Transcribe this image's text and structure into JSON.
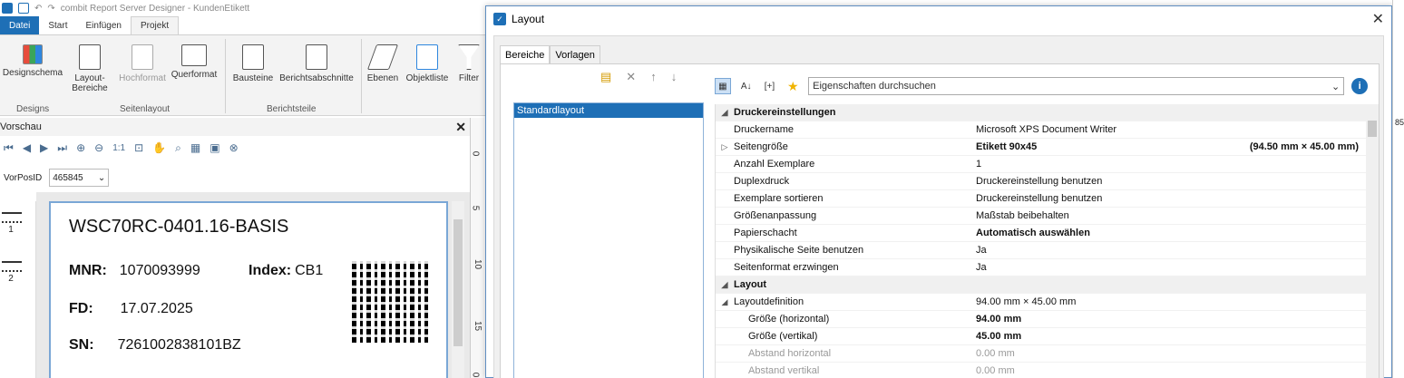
{
  "app": {
    "title": "combit Report Server Designer - KundenEtikett"
  },
  "menu": {
    "file": "Datei",
    "start": "Start",
    "insert": "Einfügen",
    "project": "Projekt"
  },
  "ribbon": {
    "designschema": "Designschema",
    "layoutbereiche": "Layout-\nBereiche",
    "hochformat": "Hochformat",
    "querformat": "Querformat",
    "bausteine": "Bausteine",
    "berichtsabschnitte": "Berichtsabschnitte",
    "ebenen": "Ebenen",
    "objektliste": "Objektliste",
    "filter": "Filter",
    "group_designs": "Designs",
    "group_seitenlayout": "Seitenlayout",
    "group_berichtsteile": "Berichtsteile"
  },
  "preview": {
    "header": "Vorschau",
    "zoom_label": "1:1",
    "vorpos_label": "VorPosID",
    "vorpos_value": "465845",
    "thumb1": "1",
    "thumb2": "2",
    "ruler_ticks": [
      "0",
      "5",
      "10",
      "15",
      "0"
    ]
  },
  "label": {
    "title": "WSC70RC-0401.16-BASIS",
    "mnr_label": "MNR:",
    "mnr_value": "1070093999",
    "index_label": "Index:",
    "index_value": "CB1",
    "fd_label": "FD:",
    "fd_value": "17.07.2025",
    "sn_label": "SN:",
    "sn_value": "7261002838101BZ"
  },
  "dialog": {
    "title": "Layout",
    "tab_bereiche": "Bereiche",
    "tab_vorlagen": "Vorlagen",
    "list_item": "Standardlayout",
    "search_placeholder": "Eigenschaften durchsuchen",
    "tb_brackets": "[+]",
    "info": "i"
  },
  "properties": {
    "cat1": "Druckereinstellungen",
    "rows1": [
      {
        "name": "Druckername",
        "value": "Microsoft XPS Document Writer"
      },
      {
        "name": "Seitengröße",
        "value": "Etikett 90x45",
        "extra": "(94.50 mm × 45.00 mm)"
      },
      {
        "name": "Anzahl Exemplare",
        "value": "1"
      },
      {
        "name": "Duplexdruck",
        "value": "Druckereinstellung benutzen"
      },
      {
        "name": "Exemplare sortieren",
        "value": "Druckereinstellung benutzen"
      },
      {
        "name": "Größenanpassung",
        "value": "Maßstab beibehalten"
      },
      {
        "name": "Papierschacht",
        "value": "Automatisch auswählen"
      },
      {
        "name": "Physikalische Seite benutzen",
        "value": "Ja"
      },
      {
        "name": "Seitenformat erzwingen",
        "value": "Ja"
      }
    ],
    "cat2": "Layout",
    "layoutdef": {
      "name": "Layoutdefinition",
      "value": "94.00 mm × 45.00 mm"
    },
    "rows2": [
      {
        "name": "Größe (horizontal)",
        "value": "94.00 mm"
      },
      {
        "name": "Größe (vertikal)",
        "value": "45.00 mm"
      },
      {
        "name": "Abstand horizontal",
        "value": "0.00 mm"
      },
      {
        "name": "Abstand vertikal",
        "value": "0.00 mm"
      }
    ]
  },
  "side": {
    "ruler_text": "85"
  }
}
